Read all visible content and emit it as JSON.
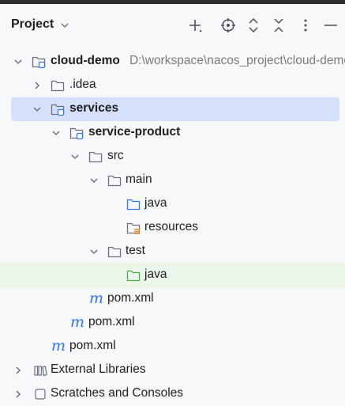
{
  "header": {
    "title": "Project"
  },
  "tree": {
    "root": {
      "name": "cloud-demo",
      "path": "D:\\workspace\\nacos_project\\cloud-demo"
    },
    "idea": "idea",
    "idea_dot": ".",
    "services": "services",
    "service_product": "service-product",
    "src": "src",
    "main": "main",
    "java_main": "java",
    "resources": "resources",
    "test": "test",
    "java_test": "java",
    "pom_product": "pom.xml",
    "pom_services": "pom.xml",
    "pom_root": "pom.xml",
    "external_libraries": "External Libraries",
    "scratches": "Scratches and Consoles"
  },
  "colors": {
    "selection": "#d5e1fb",
    "highlight": "#e9f6e9",
    "accent": "#3574f0",
    "test_folder": "#4ea94c",
    "resources_mark": "#e08a2a"
  },
  "icons": [
    "chevron-down-icon",
    "plus-icon",
    "locate-icon",
    "expand-all-icon",
    "collapse-all-icon",
    "more-icon",
    "minimize-icon",
    "folder-icon",
    "module-folder-icon",
    "source-folder-icon",
    "test-folder-icon",
    "resources-folder-icon",
    "maven-icon",
    "libraries-icon"
  ]
}
